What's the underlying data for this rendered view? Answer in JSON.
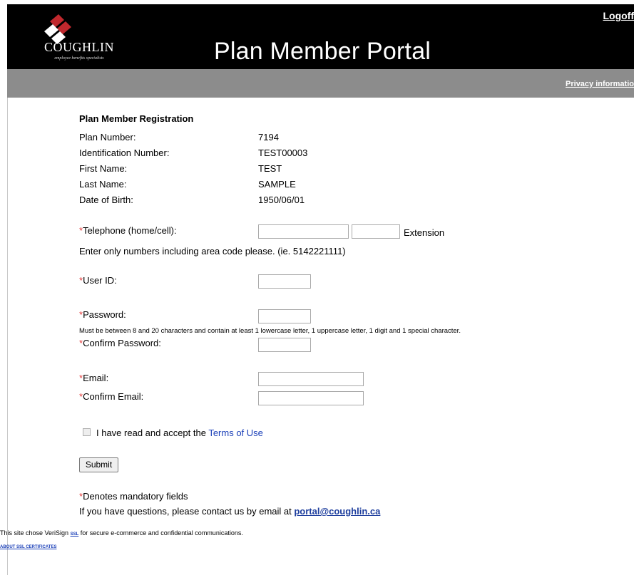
{
  "header": {
    "logo_text": "COUGHLIN",
    "logo_tagline": "employee benefits specialists",
    "title": "Plan Member Portal",
    "logoff": "Logoff",
    "privacy": "Privacy informatio"
  },
  "registration": {
    "heading": "Plan Member Registration",
    "fields": [
      {
        "label": "Plan Number:",
        "value": "7194"
      },
      {
        "label": "Identification Number:",
        "value": "TEST00003"
      },
      {
        "label": "First Name:",
        "value": "TEST"
      },
      {
        "label": "Last Name:",
        "value": "SAMPLE"
      },
      {
        "label": "Date of Birth:",
        "value": "1950/06/01"
      }
    ]
  },
  "form": {
    "required_mark": "*",
    "telephone_label": "Telephone (home/cell):",
    "extension_label": "Extension",
    "telephone_hint": "Enter only numbers including area code please. (ie. 5142221111)",
    "userid_label": "User ID:",
    "password_label": "Password:",
    "password_hint": "Must be between 8 and 20 characters and contain at least 1 lowercase letter, 1 uppercase letter, 1 digit and 1 special character.",
    "confirm_password_label": "Confirm Password:",
    "email_label": "Email:",
    "confirm_email_label": "Confirm Email:",
    "terms_prefix": "I have read and accept the ",
    "terms_link": "Terms of Use",
    "submit": "Submit",
    "mandatory_note": "Denotes mandatory fields",
    "contact_text": "If you have questions, please contact us by email at ",
    "contact_email": "portal@coughlin.ca"
  },
  "footer": {
    "ssl_prefix": "This site chose VeriSign ",
    "ssl_link": "SSL",
    "ssl_suffix": " for secure e-commerce and confidential communications.",
    "about_ssl": "ABOUT SSL CERTIFICATES"
  },
  "colors": {
    "header_bg": "#000000",
    "bar_bg": "#8c8c8c",
    "required": "#e23b3b",
    "link": "#1a3fb8"
  }
}
